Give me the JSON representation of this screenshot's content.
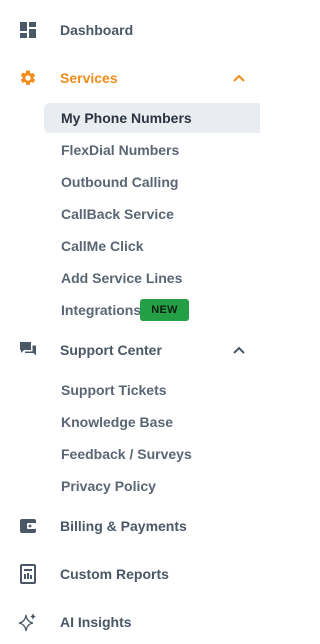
{
  "sidebar": {
    "dashboard": {
      "label": "Dashboard",
      "icon": "dashboard-grid-icon"
    },
    "services": {
      "label": "Services",
      "icon": "gear-icon",
      "expanded": true,
      "accent": "#f08c1b",
      "items": [
        {
          "label": "My Phone Numbers",
          "selected": true
        },
        {
          "label": "FlexDial Numbers"
        },
        {
          "label": "Outbound Calling"
        },
        {
          "label": "CallBack Service"
        },
        {
          "label": "CallMe Click"
        },
        {
          "label": "Add Service Lines"
        },
        {
          "label": "Integrations",
          "badge": "NEW"
        }
      ]
    },
    "support_center": {
      "label": "Support Center",
      "icon": "chat-bubbles-icon",
      "expanded": true,
      "items": [
        {
          "label": "Support Tickets"
        },
        {
          "label": "Knowledge Base"
        },
        {
          "label": "Feedback / Surveys"
        },
        {
          "label": "Privacy Policy"
        }
      ]
    },
    "billing": {
      "label": "Billing & Payments",
      "icon": "wallet-icon"
    },
    "custom_reports": {
      "label": "Custom Reports",
      "icon": "report-document-icon"
    },
    "ai_insights": {
      "label": "AI Insights",
      "icon": "sparkles-icon"
    },
    "badge_color": "#23a046",
    "text_color": "#4a5767"
  }
}
